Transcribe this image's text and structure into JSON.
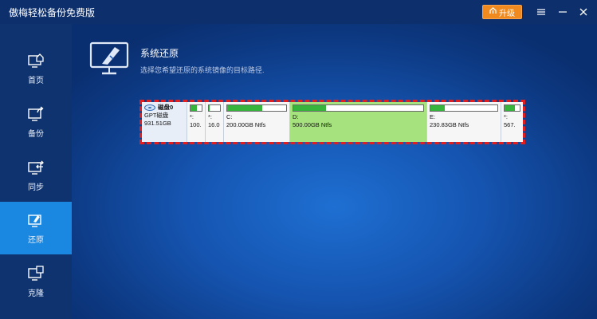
{
  "app": {
    "title": "傲梅轻松备份免费版"
  },
  "titlebar": {
    "upgrade_label": "升级"
  },
  "sidebar": {
    "items": [
      {
        "label": "首页",
        "icon": "home-icon"
      },
      {
        "label": "备份",
        "icon": "backup-icon"
      },
      {
        "label": "同步",
        "icon": "sync-icon"
      },
      {
        "label": "还原",
        "icon": "restore-icon",
        "active": true
      },
      {
        "label": "克隆",
        "icon": "clone-icon"
      }
    ]
  },
  "main": {
    "title": "系统还原",
    "subtitle": "选择您希望还原的系统镜像的目标路径."
  },
  "disk": {
    "name": "磁盘0",
    "type": "GPT磁盘",
    "size": "931.51GB",
    "partitions": [
      {
        "label": "*:",
        "info": "100.",
        "fill": 0.6
      },
      {
        "label": "*:",
        "info": "16.0",
        "fill": 0.1
      },
      {
        "label": "C:",
        "info": "200.00GB Ntfs",
        "fill": 0.6
      },
      {
        "label": "D:",
        "info": "500.00GB Ntfs",
        "fill": 0.25,
        "selected": true
      },
      {
        "label": "E:",
        "info": "230.83GB Ntfs",
        "fill": 0.22
      },
      {
        "label": "*:",
        "info": "567.",
        "fill": 0.7
      }
    ]
  },
  "colors": {
    "accent": "#1a87e0",
    "upgrade": "#f08a1e",
    "selection_border": "#e02020",
    "selected_partition": "#a6e37e"
  }
}
